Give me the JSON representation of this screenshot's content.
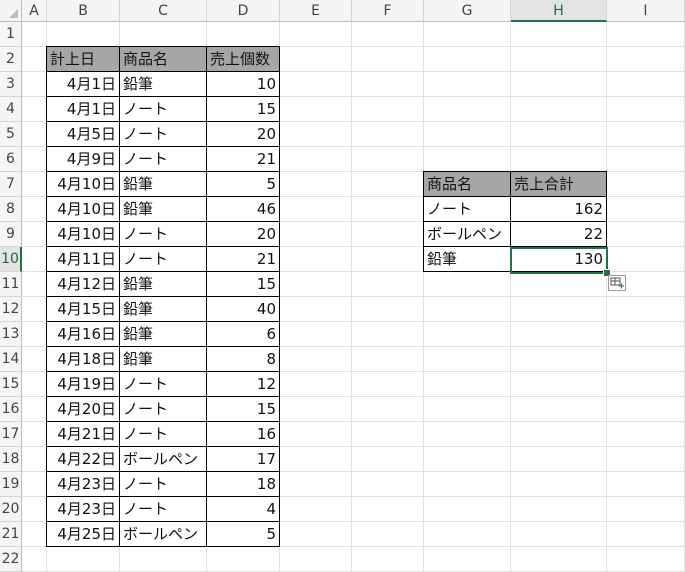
{
  "columns": [
    "A",
    "B",
    "C",
    "D",
    "E",
    "F",
    "G",
    "H",
    "I"
  ],
  "rows": [
    "1",
    "2",
    "3",
    "4",
    "5",
    "6",
    "7",
    "8",
    "9",
    "10",
    "11",
    "12",
    "13",
    "14",
    "15",
    "16",
    "17",
    "18",
    "19",
    "20",
    "21",
    "22"
  ],
  "selected": {
    "column": "H",
    "row": "10"
  },
  "sales_table": {
    "headers": [
      "計上日",
      "商品名",
      "売上個数"
    ],
    "rows": [
      [
        "4月1日",
        "鉛筆",
        "10"
      ],
      [
        "4月1日",
        "ノート",
        "15"
      ],
      [
        "4月5日",
        "ノート",
        "20"
      ],
      [
        "4月9日",
        "ノート",
        "21"
      ],
      [
        "4月10日",
        "鉛筆",
        "5"
      ],
      [
        "4月10日",
        "鉛筆",
        "46"
      ],
      [
        "4月10日",
        "ノート",
        "20"
      ],
      [
        "4月11日",
        "ノート",
        "21"
      ],
      [
        "4月12日",
        "鉛筆",
        "15"
      ],
      [
        "4月15日",
        "鉛筆",
        "40"
      ],
      [
        "4月16日",
        "鉛筆",
        "6"
      ],
      [
        "4月18日",
        "鉛筆",
        "8"
      ],
      [
        "4月19日",
        "ノート",
        "12"
      ],
      [
        "4月20日",
        "ノート",
        "15"
      ],
      [
        "4月21日",
        "ノート",
        "16"
      ],
      [
        "4月22日",
        "ボールペン",
        "17"
      ],
      [
        "4月23日",
        "ノート",
        "18"
      ],
      [
        "4月23日",
        "ノート",
        "4"
      ],
      [
        "4月25日",
        "ボールペン",
        "5"
      ]
    ]
  },
  "summary_table": {
    "headers": [
      "商品名",
      "売上合計"
    ],
    "rows": [
      [
        "ノート",
        "162"
      ],
      [
        "ボールペン",
        "22"
      ],
      [
        "鉛筆",
        "130"
      ]
    ]
  },
  "colors": {
    "header_fill": "#a6a6a6",
    "selection": "#217346",
    "gridline": "#e1e1e1"
  },
  "icons": {
    "quick_analysis": "quick-analysis-icon"
  }
}
